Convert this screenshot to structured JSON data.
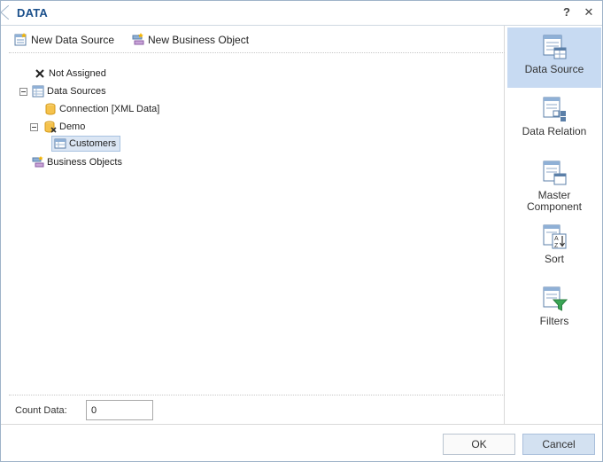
{
  "dialog": {
    "title": "DATA",
    "help_label": "?",
    "close_label": "✕"
  },
  "toolbar": {
    "new_data_source": "New Data Source",
    "new_business_object": "New Business Object"
  },
  "tree": {
    "not_assigned": "Not Assigned",
    "data_sources": "Data Sources",
    "connection": "Connection [XML Data]",
    "demo": "Demo",
    "customers": "Customers",
    "business_objects": "Business Objects"
  },
  "count": {
    "label": "Count Data:",
    "value": "0"
  },
  "sidebar": {
    "items": [
      {
        "label": "Data Source",
        "active": true
      },
      {
        "label": "Data Relation"
      },
      {
        "label": "Master Component"
      },
      {
        "label": "Sort"
      },
      {
        "label": "Filters"
      }
    ]
  },
  "footer": {
    "ok": "OK",
    "cancel": "Cancel"
  },
  "colors": {
    "title": "#1a4f8b",
    "active_tab": "#c7daf2",
    "selected_node": "#dbe6f4",
    "cancel_button": "#d3e1f1"
  }
}
